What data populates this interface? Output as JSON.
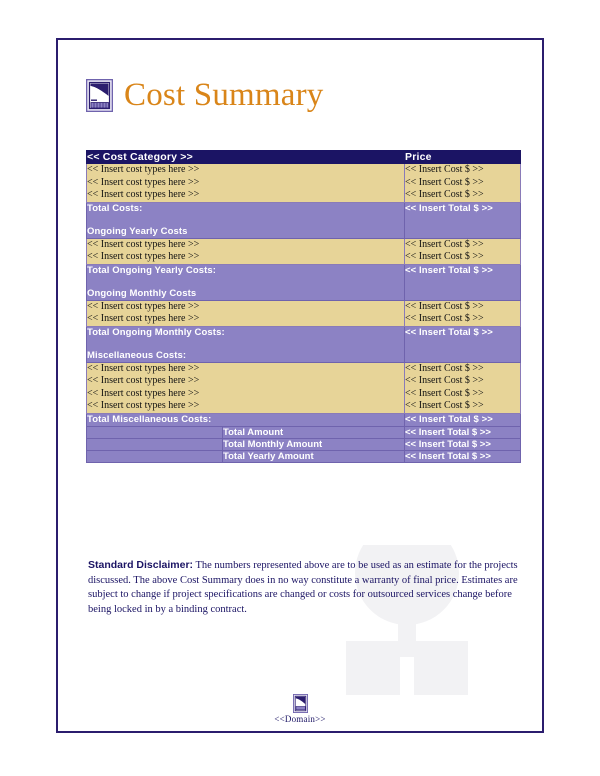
{
  "document": {
    "title": "Cost Summary",
    "title_icon": "document-chart-icon",
    "accent_color": "#d98519",
    "border_color": "#2b1d6e",
    "header_fill": "#1b1464",
    "item_fill": "#e7d498",
    "total_fill": "#8c82c4"
  },
  "table": {
    "columns": [
      "<< Cost Category >>",
      "Price"
    ],
    "sections": [
      {
        "type": "items",
        "rows": [
          {
            "label": "<< Insert cost types here >>",
            "price": "<< Insert Cost $ >>"
          },
          {
            "label": "<< Insert cost types here >>",
            "price": "<< Insert Cost $ >>"
          },
          {
            "label": "<< Insert cost types here >>",
            "price": "<< Insert Cost $ >>"
          }
        ]
      },
      {
        "type": "total",
        "label": "Total Costs:",
        "sublabel": "Ongoing Yearly Costs",
        "price": "<< Insert Total $ >>"
      },
      {
        "type": "items",
        "rows": [
          {
            "label": "<< Insert cost types here >>",
            "price": "<< Insert Cost $ >>"
          },
          {
            "label": "<< Insert cost types here >>",
            "price": "<< Insert Cost $ >>"
          }
        ]
      },
      {
        "type": "total",
        "label": "Total Ongoing Yearly Costs:",
        "sublabel": "Ongoing Monthly Costs",
        "price": "<< Insert Total $ >>"
      },
      {
        "type": "items",
        "rows": [
          {
            "label": "<< Insert cost types here >>",
            "price": "<< Insert Cost $ >>"
          },
          {
            "label": "<< Insert cost types here >>",
            "price": "<< Insert Cost $ >>"
          }
        ]
      },
      {
        "type": "total",
        "label": "Total Ongoing Monthly Costs:",
        "sublabel": "Miscellaneous Costs:",
        "price": "<< Insert Total $ >>"
      },
      {
        "type": "items",
        "rows": [
          {
            "label": "<< Insert cost types here >>",
            "price": "<< Insert Cost $ >>"
          },
          {
            "label": "<< Insert cost types here >>",
            "price": "<< Insert Cost $ >>"
          },
          {
            "label": "<< Insert cost types here >>",
            "price": "<< Insert Cost $ >>"
          },
          {
            "label": "<< Insert cost types here >>",
            "price": "<< Insert Cost $ >>"
          }
        ]
      },
      {
        "type": "total",
        "label": "Total Miscellaneous Costs:",
        "sublabel": "",
        "price": "<< Insert Total $ >>"
      }
    ],
    "summary_rows": [
      {
        "label": "Total Amount",
        "price": "<< Insert Total $ >>"
      },
      {
        "label": "Total Monthly Amount",
        "price": "<< Insert Total $ >>"
      },
      {
        "label": "Total Yearly Amount",
        "price": "<< Insert Total $ >>"
      }
    ]
  },
  "disclaimer": {
    "lead": "Standard Disclaimer:",
    "body": " The numbers represented above are to be used as an estimate for the projects discussed. The above Cost Summary does in no way constitute a warranty of final price. Estimates are subject to change if project specifications are changed or costs for outsourced services change before being locked in by a binding contract."
  },
  "footer": {
    "icon": "document-chart-icon",
    "text": "<<Domain>>"
  }
}
